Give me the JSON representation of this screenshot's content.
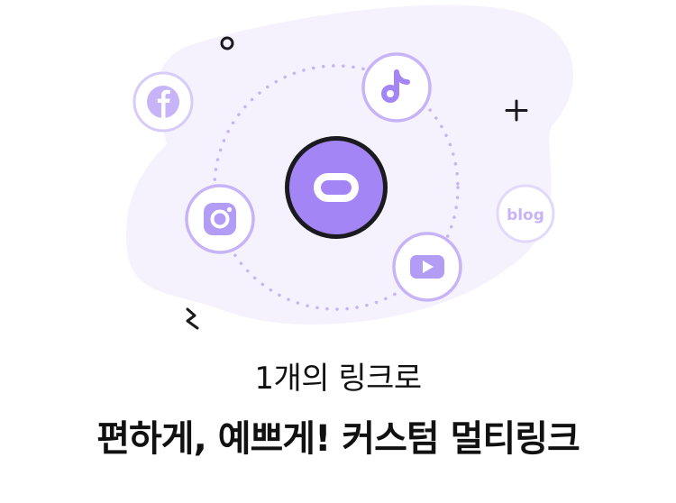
{
  "subtitle": "1개의 링크로",
  "headline": "편하게, 예쁘게! 커스텀 멀티링크",
  "icons": {
    "center": "link-icon",
    "satellites": [
      "tiktok-icon",
      "instagram-icon",
      "youtube-icon",
      "facebook-icon",
      "blog-icon"
    ],
    "blog_text": "blog"
  },
  "colors": {
    "accent": "#a385f5",
    "accent_light": "#c7b3f7",
    "blob": "#f5f2fd",
    "ring_border": "#d8cbf9",
    "dark": "#1b1a1f"
  }
}
